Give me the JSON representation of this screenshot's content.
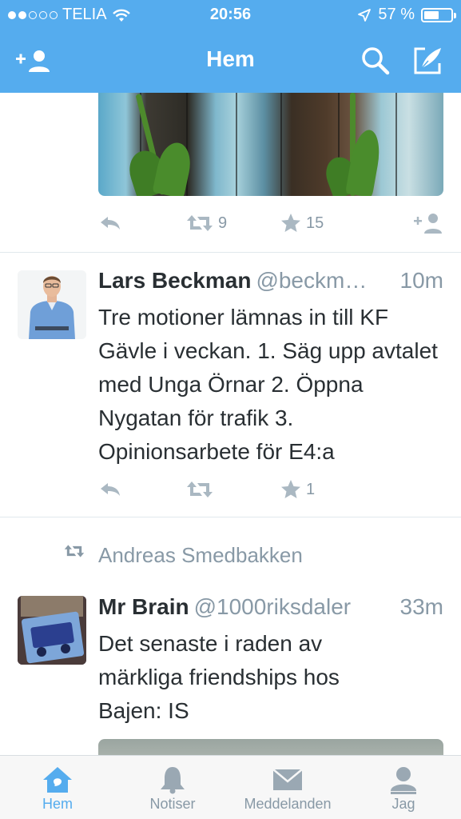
{
  "status_bar": {
    "carrier": "TELIA",
    "time": "20:56",
    "battery_percent": "57 %",
    "battery_level": 0.57,
    "signal_bars": 2
  },
  "nav": {
    "title": "Hem",
    "left_icon": "add-user-icon",
    "right_icons": [
      "search-icon",
      "compose-icon"
    ]
  },
  "tweets": [
    {
      "media": "photo-tulips-wooden-fence",
      "actions": {
        "retweets": "9",
        "favorites": "15"
      }
    },
    {
      "name": "Lars Beckman",
      "handle": "@beckm…",
      "time": "10m",
      "text": "Tre motioner lämnas in till KF Gävle i veckan. 1. Säg upp avtalet med Unga Örnar  2. Öppna Nygatan för trafik 3. Opinionsarbete för E4:a",
      "actions": {
        "retweets": "",
        "favorites": "1"
      }
    },
    {
      "retweeted_by": "Andreas Smedbakken",
      "name": "Mr Brain",
      "handle": "@1000riksdaler",
      "time": "33m",
      "text": "Det senaste i raden av märkliga friendships hos Bajen: IS"
    }
  ],
  "tabs": [
    {
      "label": "Hem",
      "icon": "home-icon",
      "active": true
    },
    {
      "label": "Notiser",
      "icon": "bell-icon",
      "active": false
    },
    {
      "label": "Meddelanden",
      "icon": "envelope-icon",
      "active": false
    },
    {
      "label": "Jag",
      "icon": "person-icon",
      "active": false
    }
  ],
  "colors": {
    "brand": "#55acee",
    "muted": "#8899a6",
    "text": "#292f33"
  }
}
